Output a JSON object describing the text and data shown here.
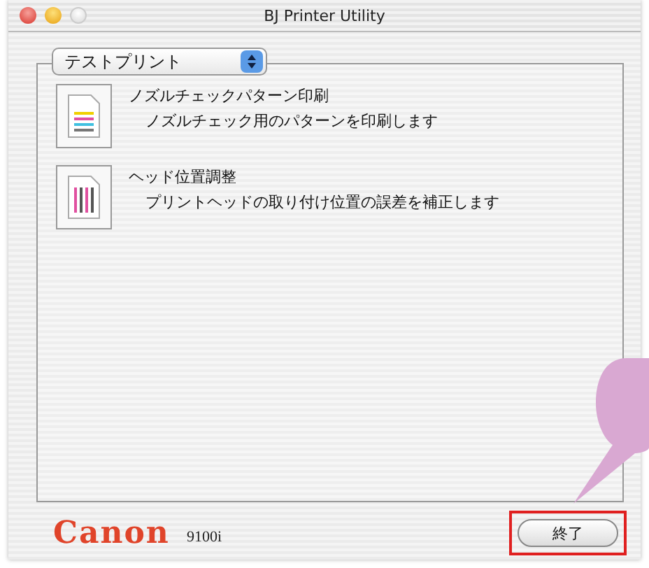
{
  "window": {
    "title": "BJ Printer Utility"
  },
  "menu": {
    "value": "テストプリント"
  },
  "items": [
    {
      "kind": "nozzle",
      "title": "ノズルチェックパターン印刷",
      "description": "ノズルチェック用のパターンを印刷します"
    },
    {
      "kind": "head",
      "title": "ヘッド位置調整",
      "description": "プリントヘッドの取り付け位置の誤差を補正します"
    }
  ],
  "footer": {
    "brand": "Canon",
    "model": "9100i",
    "button": "終了"
  }
}
